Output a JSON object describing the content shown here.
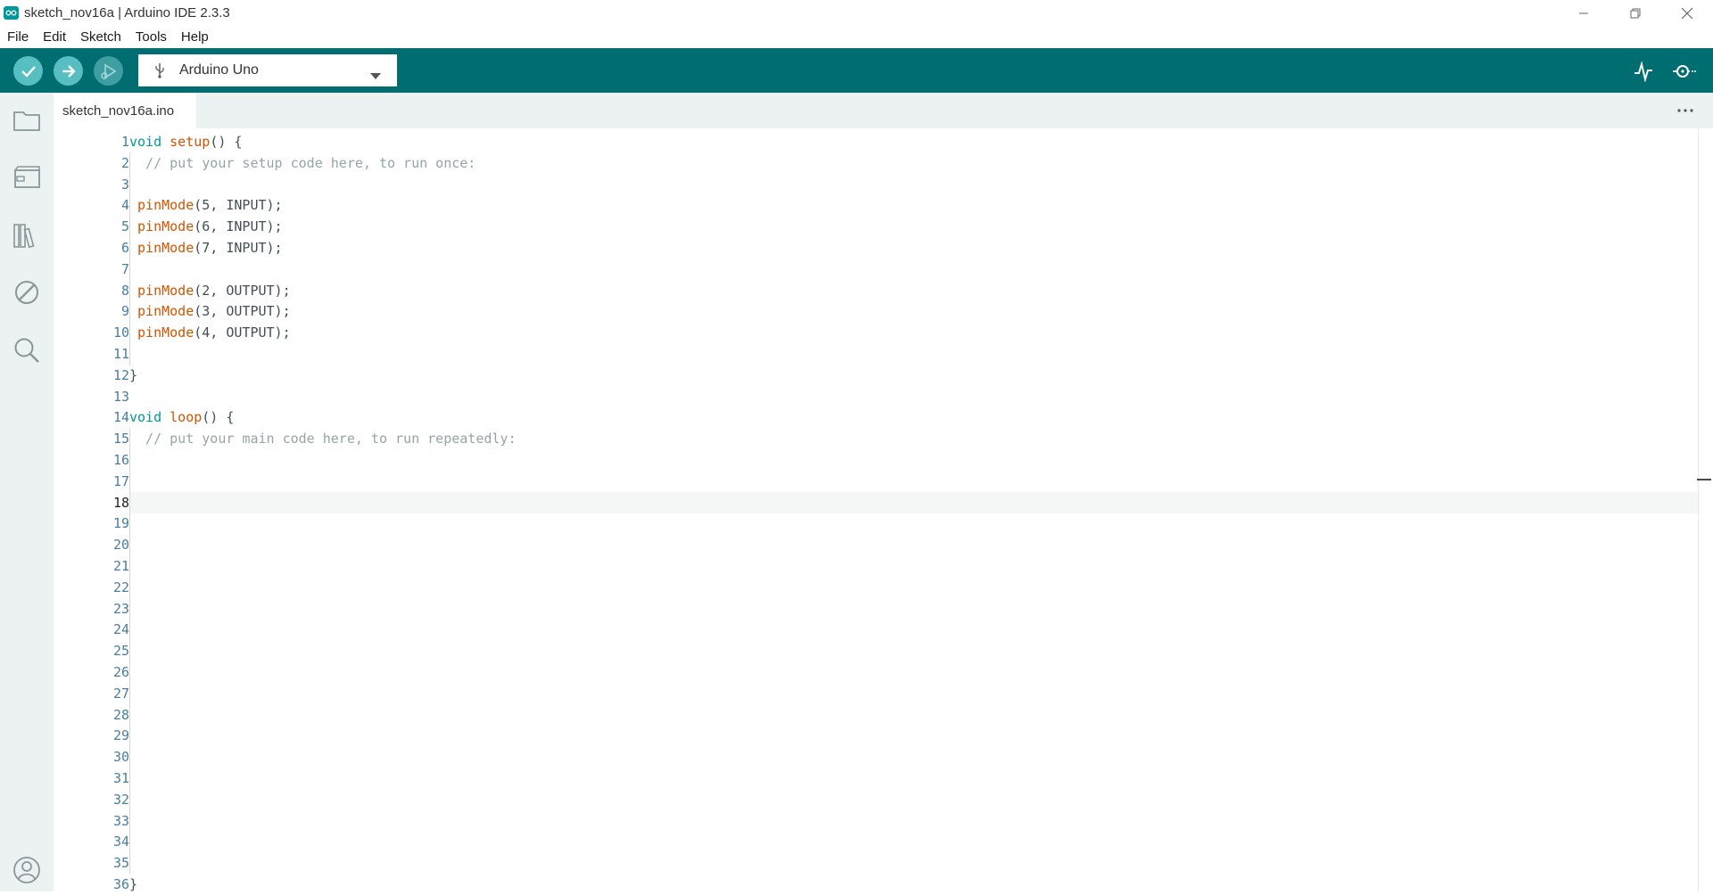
{
  "window": {
    "title": "sketch_nov16a | Arduino IDE 2.3.3",
    "controls": [
      "minimize",
      "restore",
      "close"
    ]
  },
  "menu": [
    "File",
    "Edit",
    "Sketch",
    "Tools",
    "Help"
  ],
  "toolbar": {
    "verify_icon": "check-icon",
    "upload_icon": "arrow-right-icon",
    "debug_icon": "debug-icon",
    "board": "Arduino Uno",
    "serial_plotter_icon": "plotter-icon",
    "serial_monitor_icon": "monitor-icon"
  },
  "sidebar": [
    "folder-icon",
    "board-manager-icon",
    "library-icon",
    "debug-disabled-icon",
    "search-icon",
    "account-icon"
  ],
  "tab": {
    "filename": "sketch_nov16a.ino"
  },
  "editor": {
    "active_line": 18,
    "line_count": 36,
    "lines": [
      {
        "n": 1,
        "t": "void setup() {"
      },
      {
        "n": 2,
        "t": "  // put your setup code here, to run once:"
      },
      {
        "n": 3,
        "t": ""
      },
      {
        "n": 4,
        "t": " pinMode(5, INPUT);"
      },
      {
        "n": 5,
        "t": " pinMode(6, INPUT);"
      },
      {
        "n": 6,
        "t": " pinMode(7, INPUT);"
      },
      {
        "n": 7,
        "t": ""
      },
      {
        "n": 8,
        "t": " pinMode(2, OUTPUT);"
      },
      {
        "n": 9,
        "t": " pinMode(3, OUTPUT);"
      },
      {
        "n": 10,
        "t": " pinMode(4, OUTPUT);"
      },
      {
        "n": 11,
        "t": ""
      },
      {
        "n": 12,
        "t": "}"
      },
      {
        "n": 13,
        "t": ""
      },
      {
        "n": 14,
        "t": "void loop() {"
      },
      {
        "n": 15,
        "t": "  // put your main code here, to run repeatedly:"
      },
      {
        "n": 16,
        "t": ""
      },
      {
        "n": 17,
        "t": ""
      },
      {
        "n": 18,
        "t": ""
      },
      {
        "n": 19,
        "t": ""
      },
      {
        "n": 20,
        "t": ""
      },
      {
        "n": 21,
        "t": ""
      },
      {
        "n": 22,
        "t": ""
      },
      {
        "n": 23,
        "t": ""
      },
      {
        "n": 24,
        "t": ""
      },
      {
        "n": 25,
        "t": ""
      },
      {
        "n": 26,
        "t": ""
      },
      {
        "n": 27,
        "t": ""
      },
      {
        "n": 28,
        "t": ""
      },
      {
        "n": 29,
        "t": ""
      },
      {
        "n": 30,
        "t": ""
      },
      {
        "n": 31,
        "t": ""
      },
      {
        "n": 32,
        "t": ""
      },
      {
        "n": 33,
        "t": ""
      },
      {
        "n": 34,
        "t": ""
      },
      {
        "n": 35,
        "t": ""
      },
      {
        "n": 36,
        "t": "}"
      }
    ]
  }
}
